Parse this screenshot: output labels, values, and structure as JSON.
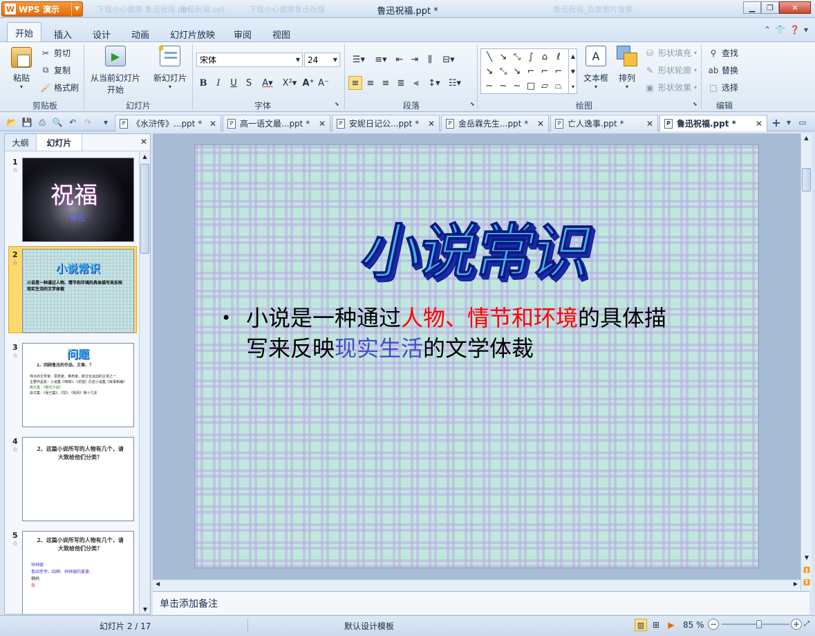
{
  "app": {
    "name": "WPS 演示",
    "window_title": "鲁迅祝福.ppt *",
    "ghost_tabs": [
      "下载小心健康 鲁迅祝福.ppt",
      "鲁迅祝福.ppt",
      "下载小心健康鲁迅祝福",
      "鲁迅祝福_百度图片搜索"
    ]
  },
  "menu": {
    "tabs": [
      "开始",
      "插入",
      "设计",
      "动画",
      "幻灯片放映",
      "审阅",
      "视图"
    ],
    "active": "开始"
  },
  "ribbon": {
    "clipboard": {
      "paste": "粘贴",
      "cut": "剪切",
      "copy": "复制",
      "format_painter": "格式刷",
      "label": "剪贴板"
    },
    "slideshow": {
      "from_current_line1": "从当前幻灯片",
      "from_current_line2": "开始",
      "label": "幻灯片"
    },
    "newslide": {
      "label": "新幻灯片"
    },
    "font": {
      "name": "宋体",
      "size": "24",
      "label": "字体"
    },
    "paragraph": {
      "label": "段落"
    },
    "drawing": {
      "textbox": "文本框",
      "arrange": "排列",
      "shape_fill": "形状填充",
      "shape_outline": "形状轮廓",
      "shape_effect": "形状效果",
      "label": "绘图"
    },
    "editing": {
      "find": "查找",
      "replace": "替换",
      "select": "选择",
      "label": "编辑"
    }
  },
  "doc_tabs": [
    "《水浒传》...ppt *",
    "高一语文最...ppt *",
    "安妮日记公...ppt *",
    "金岳霖先生...ppt *",
    "亡人逸事.ppt *",
    "鲁迅祝福.ppt *"
  ],
  "active_doc_tab": 5,
  "left_pane": {
    "tab_outline": "大纲",
    "tab_slides": "幻灯片",
    "slides": [
      {
        "num": "1",
        "title": "祝福",
        "subtitle": "鲁迅"
      },
      {
        "num": "2",
        "title": "小说常识",
        "text": "小说是一种通过人物、情节和环境的具体描写来反映现实生活的文学体裁"
      },
      {
        "num": "3",
        "title": "问题",
        "q": "1、回顾鲁迅的作品、文章、？",
        "lines": [
          "伟大的文学家、思想家、革命家。新文化运动的主将之一",
          "主要作品有：小说集《呐喊》、《彷徨》历史小说集《故事新编》",
          "散文集：《朝花夕拾》",
          "杂文集：《而已集》、《坟》、《热风》等十几本"
        ]
      },
      {
        "num": "4",
        "q": "2、这篇小说所写的人物有几个，请大致给他们分类？"
      },
      {
        "num": "5",
        "q": "2、这篇小说所写的人物有几个，请大致给他们分类？",
        "items": [
          "祥林嫂",
          "鲁四老爷、四婶、祥林嫂的婆婆、",
          "柳妈",
          "我"
        ]
      }
    ]
  },
  "slide": {
    "title": "小说常识",
    "bullet": "•",
    "body": {
      "p1": "小说是一种通过",
      "red": "人物、情节和环境",
      "p2": "的具体描写来反映",
      "blue": "现实生活",
      "p3": "的文学体裁"
    }
  },
  "notes_placeholder": "单击添加备注",
  "status": {
    "slide_counter": "幻灯片 2 / 17",
    "template": "默认设计模板",
    "zoom": "85 %",
    "zoom_level": 0.55
  }
}
